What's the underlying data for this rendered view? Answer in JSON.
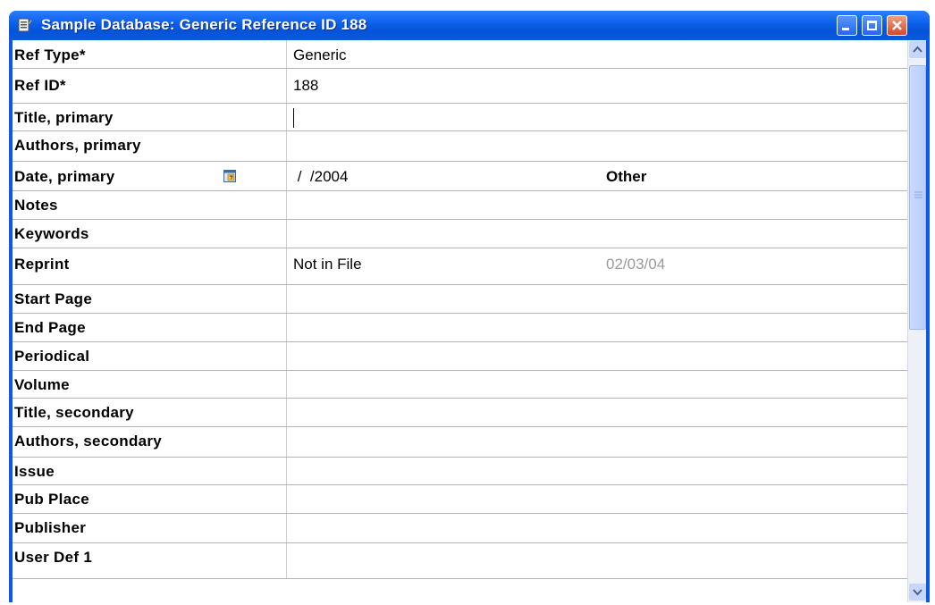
{
  "window": {
    "title": "Sample Database: Generic Reference ID 188",
    "icons": {
      "app": "database-icon",
      "minimize": "minimize-icon",
      "maximize": "maximize-icon",
      "close": "close-icon"
    }
  },
  "fields": [
    {
      "label": "Ref Type*",
      "value": "Generic"
    },
    {
      "label": "Ref ID*",
      "value": "188"
    },
    {
      "label": "Title, primary",
      "value": ""
    },
    {
      "label": "Authors, primary",
      "value": ""
    },
    {
      "label": "Date, primary",
      "value": " /  /2004",
      "extra": "Other"
    },
    {
      "label": "Notes",
      "value": ""
    },
    {
      "label": "Keywords",
      "value": ""
    },
    {
      "label": "Reprint",
      "value": "Not in File",
      "extra": "02/03/04"
    },
    {
      "label": "Start Page",
      "value": ""
    },
    {
      "label": "End Page",
      "value": ""
    },
    {
      "label": "Periodical",
      "value": ""
    },
    {
      "label": "Volume",
      "value": ""
    },
    {
      "label": "Title, secondary",
      "value": ""
    },
    {
      "label": "Authors, secondary",
      "value": ""
    },
    {
      "label": "Issue",
      "value": ""
    },
    {
      "label": "Pub Place",
      "value": ""
    },
    {
      "label": "Publisher",
      "value": ""
    },
    {
      "label": "User Def 1",
      "value": ""
    }
  ],
  "colors": {
    "titlebar": "#0a5ae6",
    "grid": "#b4b4b4",
    "muted_text": "#9a9a9a"
  }
}
